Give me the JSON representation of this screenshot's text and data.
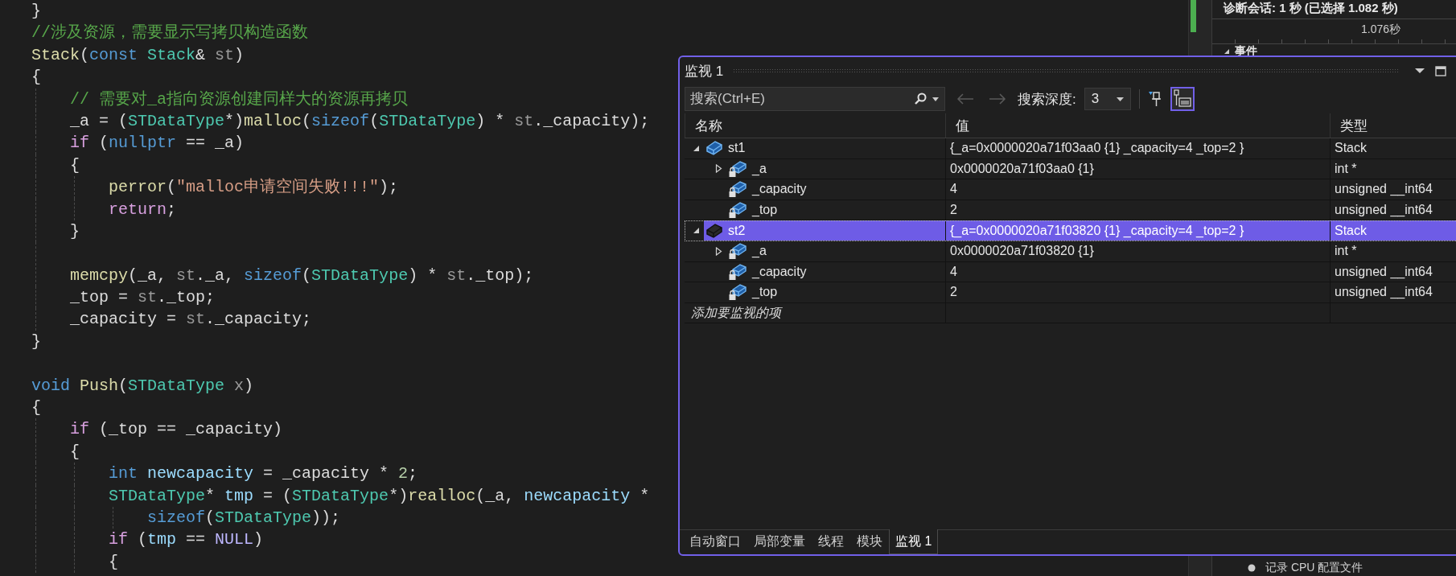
{
  "editor": {
    "code_lines": [
      {
        "tokens": [
          {
            "text": "}",
            "kind": "plain"
          }
        ]
      },
      {
        "tokens": [
          {
            "text": "//涉及资源，需要显示写拷贝构造函数",
            "kind": "comment"
          }
        ]
      },
      {
        "tokens": [
          {
            "text": "Stack",
            "kind": "function"
          },
          {
            "text": "(",
            "kind": "plain"
          },
          {
            "text": "const ",
            "kind": "keyword"
          },
          {
            "text": "Stack",
            "kind": "type"
          },
          {
            "text": "& ",
            "kind": "plain"
          },
          {
            "text": "st",
            "kind": "param"
          },
          {
            "text": ")",
            "kind": "plain"
          }
        ]
      },
      {
        "tokens": [
          {
            "text": "{",
            "kind": "plain"
          }
        ]
      },
      {
        "tokens": [
          {
            "text": "    // 需要对_a指向资源创建同样大的资源再拷贝",
            "kind": "comment"
          }
        ]
      },
      {
        "tokens": [
          {
            "text": "    _a = (",
            "kind": "plain"
          },
          {
            "text": "STDataType",
            "kind": "type"
          },
          {
            "text": "*)",
            "kind": "plain"
          },
          {
            "text": "malloc",
            "kind": "function"
          },
          {
            "text": "(",
            "kind": "plain"
          },
          {
            "text": "sizeof",
            "kind": "keyword"
          },
          {
            "text": "(",
            "kind": "plain"
          },
          {
            "text": "STDataType",
            "kind": "type"
          },
          {
            "text": ") * ",
            "kind": "plain"
          },
          {
            "text": "st",
            "kind": "param"
          },
          {
            "text": "._capacity);",
            "kind": "plain"
          }
        ]
      },
      {
        "tokens": [
          {
            "text": "    if",
            "kind": "control"
          },
          {
            "text": " (",
            "kind": "plain"
          },
          {
            "text": "nullptr",
            "kind": "keyword"
          },
          {
            "text": " == _a)",
            "kind": "plain"
          }
        ]
      },
      {
        "tokens": [
          {
            "text": "    {",
            "kind": "plain"
          }
        ]
      },
      {
        "tokens": [
          {
            "text": "        perror",
            "kind": "function"
          },
          {
            "text": "(",
            "kind": "plain"
          },
          {
            "text": "\"malloc申请空间失败!!!\"",
            "kind": "string"
          },
          {
            "text": ");",
            "kind": "plain"
          }
        ]
      },
      {
        "tokens": [
          {
            "text": "        return",
            "kind": "control"
          },
          {
            "text": ";",
            "kind": "plain"
          }
        ]
      },
      {
        "tokens": [
          {
            "text": "    }",
            "kind": "plain"
          }
        ]
      },
      {
        "blank_before": true,
        "tokens": [
          {
            "text": "    memcpy",
            "kind": "function"
          },
          {
            "text": "(_a, ",
            "kind": "plain"
          },
          {
            "text": "st",
            "kind": "param"
          },
          {
            "text": "._a, ",
            "kind": "plain"
          },
          {
            "text": "sizeof",
            "kind": "keyword"
          },
          {
            "text": "(",
            "kind": "plain"
          },
          {
            "text": "STDataType",
            "kind": "type"
          },
          {
            "text": ") * ",
            "kind": "plain"
          },
          {
            "text": "st",
            "kind": "param"
          },
          {
            "text": "._top);",
            "kind": "plain"
          }
        ]
      },
      {
        "tokens": [
          {
            "text": "    _top = ",
            "kind": "plain"
          },
          {
            "text": "st",
            "kind": "param"
          },
          {
            "text": "._top;",
            "kind": "plain"
          }
        ]
      },
      {
        "tokens": [
          {
            "text": "    _capacity = ",
            "kind": "plain"
          },
          {
            "text": "st",
            "kind": "param"
          },
          {
            "text": "._capacity;",
            "kind": "plain"
          }
        ]
      },
      {
        "tokens": [
          {
            "text": "}",
            "kind": "plain"
          }
        ]
      },
      {
        "blank_before": true,
        "tokens": [
          {
            "text": "void ",
            "kind": "keyword"
          },
          {
            "text": "Push",
            "kind": "function"
          },
          {
            "text": "(",
            "kind": "plain"
          },
          {
            "text": "STDataType ",
            "kind": "type"
          },
          {
            "text": "x",
            "kind": "param"
          },
          {
            "text": ")",
            "kind": "plain"
          }
        ]
      },
      {
        "tokens": [
          {
            "text": "{",
            "kind": "plain"
          }
        ]
      },
      {
        "tokens": [
          {
            "text": "    if",
            "kind": "control"
          },
          {
            "text": " (_top == _capacity)",
            "kind": "plain"
          }
        ]
      },
      {
        "tokens": [
          {
            "text": "    {",
            "kind": "plain"
          }
        ]
      },
      {
        "tokens": [
          {
            "text": "        int ",
            "kind": "keyword"
          },
          {
            "text": "newcapacity",
            "kind": "variable"
          },
          {
            "text": " = _capacity * ",
            "kind": "plain"
          },
          {
            "text": "2",
            "kind": "number"
          },
          {
            "text": ";",
            "kind": "plain"
          }
        ]
      },
      {
        "tokens": [
          {
            "text": "        STDataType",
            "kind": "type"
          },
          {
            "text": "* ",
            "kind": "plain"
          },
          {
            "text": "tmp",
            "kind": "variable"
          },
          {
            "text": " = (",
            "kind": "plain"
          },
          {
            "text": "STDataType",
            "kind": "type"
          },
          {
            "text": "*)",
            "kind": "plain"
          },
          {
            "text": "realloc",
            "kind": "function"
          },
          {
            "text": "(_a, ",
            "kind": "plain"
          },
          {
            "text": "newcapacity",
            "kind": "variable"
          },
          {
            "text": " *",
            "kind": "plain"
          }
        ]
      },
      {
        "tokens": [
          {
            "text": "            sizeof",
            "kind": "keyword"
          },
          {
            "text": "(",
            "kind": "plain"
          },
          {
            "text": "STDataType",
            "kind": "type"
          },
          {
            "text": "));",
            "kind": "plain"
          }
        ]
      },
      {
        "tokens": [
          {
            "text": "        if",
            "kind": "control"
          },
          {
            "text": " (",
            "kind": "plain"
          },
          {
            "text": "tmp",
            "kind": "variable"
          },
          {
            "text": " == ",
            "kind": "plain"
          },
          {
            "text": "NULL",
            "kind": "macro"
          },
          {
            "text": ")",
            "kind": "plain"
          }
        ]
      },
      {
        "tokens": [
          {
            "text": "        {",
            "kind": "plain"
          }
        ]
      }
    ]
  },
  "diagnostics_panel": {
    "title": "诊断会话: 1 秒 (已选择 1.082 秒)",
    "timeline_label": "1.076秒",
    "section": {
      "label": "事件",
      "expanded": true
    },
    "list_item": "记录 CPU 配置文件"
  },
  "watch_window": {
    "title": "监视 1",
    "search": {
      "placeholder": "搜索(Ctrl+E)"
    },
    "nav_buttons": [
      {
        "kind": "back",
        "disabled": true
      },
      {
        "kind": "forward",
        "disabled": true
      }
    ],
    "search_depth_label": "搜索深度:",
    "search_depth": "3",
    "format_toggle": {
      "selected": true
    },
    "columns": [
      "名称",
      "值",
      "类型"
    ],
    "rows": [
      {
        "name": "st1",
        "value": "{_a=0x0000020a71f03aa0 {1} _capacity=4 _top=2 }",
        "type": "Stack",
        "expanded": true,
        "selected": false,
        "children": [
          {
            "name": "_a",
            "value": "0x0000020a71f03aa0 {1}",
            "type": "int *",
            "expanded": false,
            "selected": false
          },
          {
            "name": "_capacity",
            "value": "4",
            "type": "unsigned __int64",
            "selected": false
          },
          {
            "name": "_top",
            "value": "2",
            "type": "unsigned __int64",
            "selected": false
          }
        ]
      },
      {
        "name": "st2",
        "value": "{_a=0x0000020a71f03820 {1} _capacity=4 _top=2 }",
        "type": "Stack",
        "expanded": true,
        "selected": true,
        "children": [
          {
            "name": "_a",
            "value": "0x0000020a71f03820 {1}",
            "type": "int *",
            "expanded": false,
            "selected": false
          },
          {
            "name": "_capacity",
            "value": "4",
            "type": "unsigned __int64",
            "selected": false
          },
          {
            "name": "_top",
            "value": "2",
            "type": "unsigned __int64",
            "selected": false
          }
        ]
      }
    ],
    "add_item_placeholder": "添加要监视的项",
    "tabs": [
      {
        "label": "自动窗口",
        "selected": false
      },
      {
        "label": "局部变量",
        "selected": false
      },
      {
        "label": "线程",
        "selected": false
      },
      {
        "label": "模块",
        "selected": false
      },
      {
        "label": "监视 1",
        "selected": true
      }
    ]
  }
}
